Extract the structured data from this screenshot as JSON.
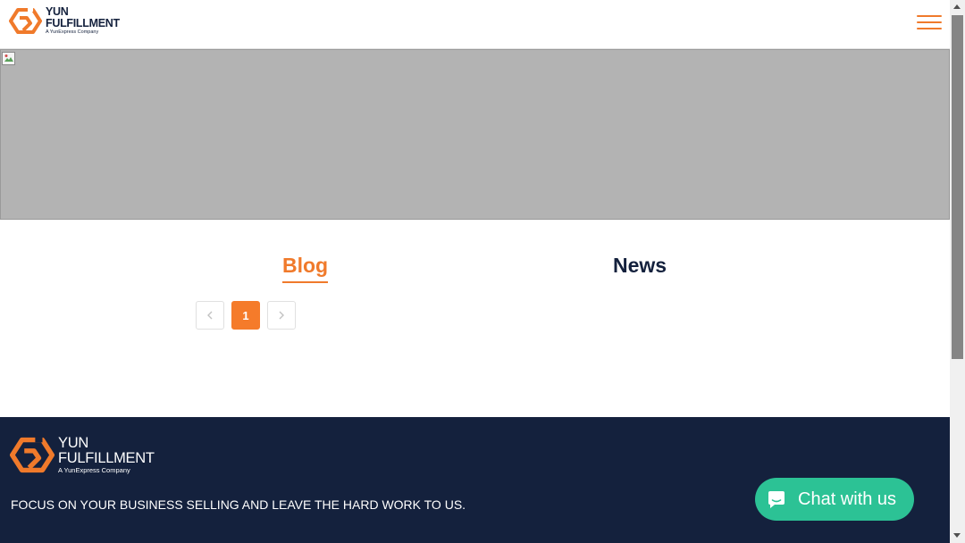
{
  "header": {
    "logo": {
      "line1": "YUN",
      "line2": "FULFILLMENT",
      "sub": "A YunExpress Company"
    },
    "menu_icon": "hamburger-menu-icon"
  },
  "banner": {
    "image_icon": "broken-image-icon"
  },
  "tabs": [
    {
      "label": "Blog",
      "active": true
    },
    {
      "label": "News",
      "active": false
    }
  ],
  "pagination": {
    "prev_icon": "chevron-left-icon",
    "pages": [
      "1"
    ],
    "current": "1",
    "next_icon": "chevron-right-icon"
  },
  "footer": {
    "logo": {
      "line1": "YUN",
      "line2": "FULFILLMENT",
      "sub": "A YunExpress Company"
    },
    "tagline": "FOCUS ON YOUR BUSINESS SELLING AND LEAVE THE HARD WORK TO US."
  },
  "chat": {
    "label": "Chat with us",
    "icon": "chat-bubble-icon"
  },
  "colors": {
    "accent": "#f07a2b",
    "navy": "#14213d",
    "chat": "#2cc295",
    "banner": "#b3b3b3"
  }
}
